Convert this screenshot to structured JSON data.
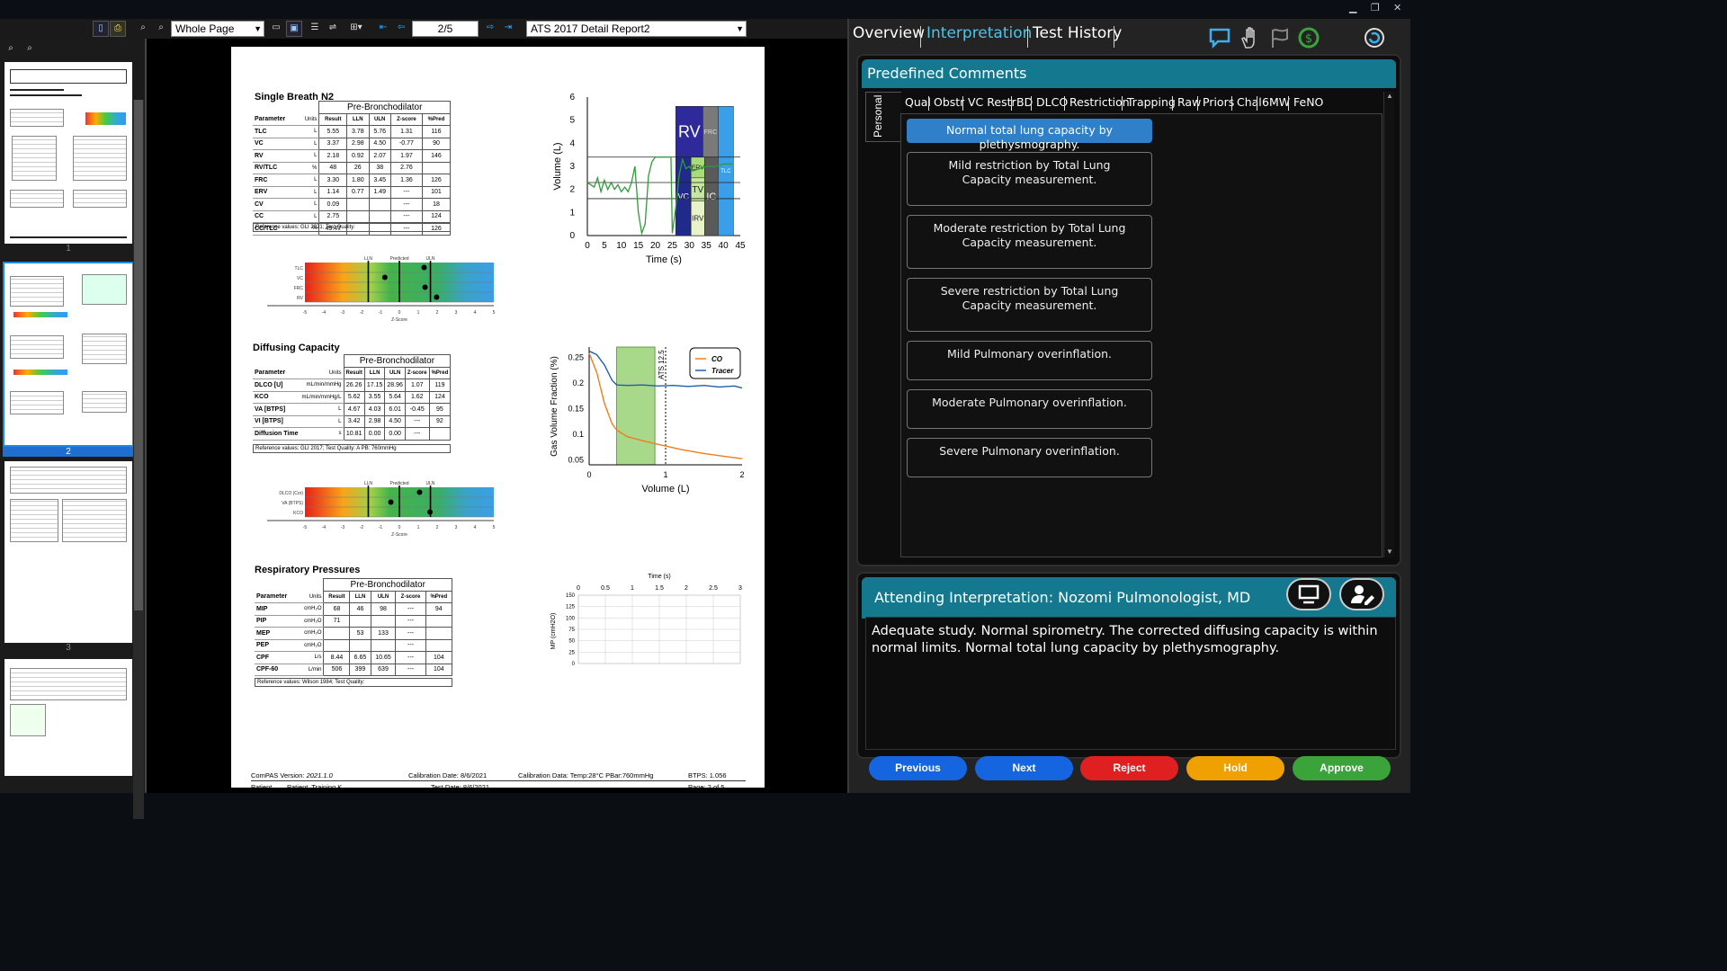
{
  "viewer": {
    "zoom_mode": "Whole Page",
    "page_indicator": "2/5",
    "report_name": "ATS 2017 Detail Report2",
    "thumbnail_selected_label": "2",
    "thumbnail_partial_labels": [
      "1",
      "3"
    ]
  },
  "report": {
    "single_breath": {
      "title": "Single Breath N2",
      "group_header": "Pre-Bronchodilator",
      "col_param": "Parameter",
      "col_units": "Units",
      "cols": [
        "Result",
        "LLN",
        "ULN",
        "Z-score",
        "%Pred"
      ],
      "rows": [
        [
          "TLC",
          "L",
          "5.55",
          "3.78",
          "5.76",
          "1.31",
          "116"
        ],
        [
          "VC",
          "L",
          "3.37",
          "2.98",
          "4.50",
          "-0.77",
          "90"
        ],
        [
          "RV",
          "L",
          "2.18",
          "0.92",
          "2.07",
          "1.97",
          "146"
        ],
        [
          "RV/TLC",
          "%",
          "48",
          "26",
          "38",
          "2.76",
          ""
        ],
        [
          "FRC",
          "L",
          "3.30",
          "1.80",
          "3.45",
          "1.36",
          "126"
        ],
        [
          "ERV",
          "L",
          "1.14",
          "0.77",
          "1.49",
          "---",
          "101"
        ],
        [
          "CV",
          "L",
          "0.09",
          "",
          "",
          "---",
          "18"
        ],
        [
          "CC",
          "L",
          "2.75",
          "",
          "",
          "---",
          "124"
        ],
        [
          "CC/TLC",
          "%",
          "49.47",
          "",
          "",
          "---",
          "126"
        ]
      ],
      "ref": "Reference values: GLI 2021; Test Quality:",
      "z_labels": [
        "TLC",
        "VC",
        "FRC",
        "RV"
      ],
      "z_markers": [
        "LLN",
        "Predicted",
        "ULN"
      ],
      "z_ticks": [
        "-5",
        "-4",
        "-3",
        "-2",
        "-1",
        "0",
        "1",
        "2",
        "3",
        "4",
        "5"
      ],
      "z_axis": "Z-Score"
    },
    "volume_chart": {
      "ylabel": "Volume (L)",
      "xlabel": "Time (s)",
      "yticks": [
        "0",
        "1",
        "2",
        "3",
        "4",
        "5",
        "6"
      ],
      "xticks": [
        "0",
        "5",
        "10",
        "15",
        "20",
        "25",
        "30",
        "35",
        "40",
        "45"
      ],
      "boxes": [
        "RV",
        "FRC",
        "VC",
        "ERV",
        "TV",
        "IRV",
        "IC",
        "TLC"
      ]
    },
    "diffusing": {
      "title": "Diffusing Capacity",
      "group_header": "Pre-Bronchodilator",
      "col_param": "Parameter",
      "col_units": "Units",
      "cols": [
        "Result",
        "LLN",
        "ULN",
        "Z-score",
        "%Pred"
      ],
      "rows": [
        [
          "DLCO [U]",
          "mL/min/mmHg",
          "26.26",
          "17.15",
          "28.96",
          "1.07",
          "119"
        ],
        [
          "KCO",
          "mL/min/mmHg/L",
          "5.62",
          "3.55",
          "5.64",
          "1.62",
          "124"
        ],
        [
          "VA [BTPS]",
          "L",
          "4.67",
          "4.03",
          "6.01",
          "-0.45",
          "95"
        ],
        [
          "VI [BTPS]",
          "L",
          "3.42",
          "2.98",
          "4.50",
          "---",
          "92"
        ],
        [
          "Diffusion Time",
          "s",
          "10.81",
          "0.00",
          "0.00",
          "---",
          ""
        ]
      ],
      "ref": "Reference values: GLI 2017; Test Quality: A      PB: 760mmHg",
      "z_labels": [
        "DLCO (Cor)",
        "VA (BTPS)",
        "KCO"
      ],
      "z_markers": [
        "LLN",
        "Predicted",
        "ULN"
      ],
      "z_ticks": [
        "-5",
        "-4",
        "-3",
        "-2",
        "-1",
        "0",
        "1",
        "2",
        "3",
        "4",
        "5"
      ],
      "z_axis": "Z-Score"
    },
    "gas_chart": {
      "ylabel": "Gas Volume Fraction (%)",
      "xlabel": "Volume (L)",
      "yticks": [
        "0.05",
        "0.1",
        "0.15",
        "0.2",
        "0.25"
      ],
      "xticks": [
        "0",
        "1",
        "2"
      ],
      "legend": [
        "CO",
        "Tracer"
      ],
      "annotation": "ATS 12.5",
      "colors": {
        "co": "#f07d1e",
        "tracer": "#1f5fa8"
      }
    },
    "respiratory": {
      "title": "Respiratory Pressures",
      "group_header": "Pre-Bronchodilator",
      "col_param": "Parameter",
      "col_units": "Units",
      "cols": [
        "Result",
        "LLN",
        "ULN",
        "Z-score",
        "%Pred"
      ],
      "rows": [
        [
          "MIP",
          "cmH₂O",
          "68",
          "46",
          "98",
          "---",
          "94"
        ],
        [
          "PIP",
          "cmH₂O",
          "71",
          "",
          "",
          "---",
          ""
        ],
        [
          "MEP",
          "cmH₂O",
          "",
          "53",
          "133",
          "---",
          ""
        ],
        [
          "PEP",
          "cmH₂O",
          "",
          "",
          "",
          "---",
          ""
        ],
        [
          "CPF",
          "L/s",
          "8.44",
          "6.65",
          "10.65",
          "---",
          "104"
        ],
        [
          "CPF-60",
          "L/min",
          "506",
          "399",
          "639",
          "---",
          "104"
        ]
      ],
      "ref": "Reference values: Wilson 1984; Test Quality:"
    },
    "mp_chart": {
      "title": "Time (s)",
      "ylabel": "MP (cmH2O)",
      "xticks": [
        "0",
        "0.5",
        "1",
        "1.5",
        "2",
        "2.5",
        "3"
      ],
      "yticks": [
        "150",
        "125",
        "100",
        "75",
        "50",
        "25",
        "0"
      ]
    },
    "footer": {
      "version_label": "ComPAS Version:",
      "version": "2021.1.0",
      "calibration_date": "Calibration Date:  8/6/2021",
      "calibration_data": "Calibration Data:   Temp:28°C   PBar:760mmHg",
      "btps": "BTPS: 1.056",
      "patient_label": "Patient",
      "patient": "Patient, Training K.",
      "test_date": "Test Date: 8/6/2021",
      "page": "Page: 2 of 5"
    }
  },
  "panel": {
    "tabs": [
      "Overview",
      "Interpretation",
      "Test History"
    ],
    "predefined_title": "Predefined Comments",
    "side_tab": "Personal",
    "subtabs": [
      "Qual",
      "Obstr",
      "VC Restr",
      "BD",
      "DLCO",
      "Restriction",
      "Trapping",
      "Raw",
      "Priors",
      "Chal",
      "6MW",
      "FeNO"
    ],
    "comments": [
      "Normal total lung capacity by plethysmography.",
      "Mild restriction by Total Lung Capacity measurement.",
      "Moderate restriction by Total Lung Capacity measurement.",
      "Severe restriction by Total Lung Capacity measurement.",
      "Mild Pulmonary overinflation.",
      "Moderate Pulmonary overinflation.",
      "Severe Pulmonary overinflation."
    ],
    "attending_title": "Attending Interpretation: Nozomi Pulmonologist, MD",
    "interpretation_text": "Adequate study.  Normal spirometry.  The corrected diffusing capacity is within normal limits. Normal total lung capacity by plethysmography.",
    "buttons": [
      "Previous",
      "Next",
      "Reject",
      "Hold",
      "Approve"
    ],
    "button_colors": {
      "previous": "#1565e0",
      "next": "#1565e0",
      "reject": "#e02020",
      "hold": "#f0a000",
      "approve": "#3aa33a"
    },
    "accent": "#4fc3e8"
  }
}
